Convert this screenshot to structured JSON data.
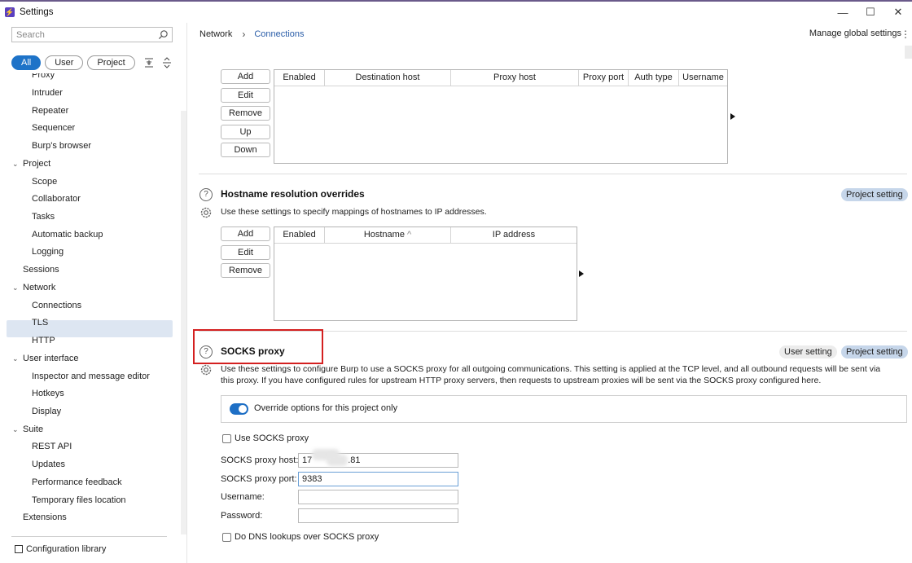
{
  "window": {
    "title": "Settings",
    "controls": [
      "—",
      "☐",
      "✕"
    ]
  },
  "sidebar": {
    "search_placeholder": "Search",
    "filters": [
      "All",
      "User",
      "Project"
    ],
    "items": [
      {
        "label": "Proxy",
        "level": 2
      },
      {
        "label": "Intruder",
        "level": 2
      },
      {
        "label": "Repeater",
        "level": 2
      },
      {
        "label": "Sequencer",
        "level": 2
      },
      {
        "label": "Burp's browser",
        "level": 2
      },
      {
        "label": "Project",
        "level": 1,
        "expanded": true
      },
      {
        "label": "Scope",
        "level": 2
      },
      {
        "label": "Collaborator",
        "level": 2
      },
      {
        "label": "Tasks",
        "level": 2
      },
      {
        "label": "Automatic backup",
        "level": 2
      },
      {
        "label": "Logging",
        "level": 2
      },
      {
        "label": "Sessions",
        "level": 1
      },
      {
        "label": "Network",
        "level": 1,
        "expanded": true
      },
      {
        "label": "Connections",
        "level": 2,
        "selected": true
      },
      {
        "label": "TLS",
        "level": 2
      },
      {
        "label": "HTTP",
        "level": 2
      },
      {
        "label": "User interface",
        "level": 1,
        "expanded": true
      },
      {
        "label": "Inspector and message editor",
        "level": 2
      },
      {
        "label": "Hotkeys",
        "level": 2
      },
      {
        "label": "Display",
        "level": 2
      },
      {
        "label": "Suite",
        "level": 1,
        "expanded": true
      },
      {
        "label": "REST API",
        "level": 2
      },
      {
        "label": "Updates",
        "level": 2
      },
      {
        "label": "Performance feedback",
        "level": 2
      },
      {
        "label": "Temporary files location",
        "level": 2
      },
      {
        "label": "Extensions",
        "level": 1
      }
    ],
    "config_library": "Configuration library"
  },
  "header": {
    "breadcrumb": [
      "Network",
      "Connections"
    ],
    "manage_global": "Manage global settings"
  },
  "upstream": {
    "buttons": [
      "Add",
      "Edit",
      "Remove",
      "Up",
      "Down"
    ],
    "columns": [
      "Enabled",
      "Destination host",
      "Proxy host",
      "Proxy port",
      "Auth type",
      "Username"
    ]
  },
  "hostname_overrides": {
    "title": "Hostname resolution overrides",
    "description": "Use these settings to specify mappings of hostnames to IP addresses.",
    "tag_project": "Project setting",
    "buttons": [
      "Add",
      "Edit",
      "Remove"
    ],
    "columns": [
      "Enabled",
      "Hostname",
      "IP address"
    ]
  },
  "socks": {
    "title": "SOCKS proxy",
    "tag_user": "User setting",
    "tag_project": "Project setting",
    "description_line1": "Use these settings to configure Burp to use a SOCKS proxy for all outgoing communications. This setting is applied at the TCP level, and all outbound requests will be sent via",
    "description_line2": "this proxy. If you have configured rules for upstream HTTP proxy servers, then requests to upstream proxies will be sent via the SOCKS proxy configured here.",
    "override_label": "Override options for this project only",
    "override_enabled": true,
    "use_socks_label": "Use SOCKS proxy",
    "host_label": "SOCKS proxy host:",
    "host_value_prefix": "17",
    "host_value_suffix": ".81",
    "port_label": "SOCKS proxy port:",
    "port_value": "9383",
    "username_label": "Username:",
    "password_label": "Password:",
    "dns_label": "Do DNS lookups over SOCKS proxy"
  },
  "colors": {
    "accent": "#1e73c8",
    "highlight": "#d42020",
    "selected_bg": "#dde6f2",
    "project_tag": "#c6d6ea"
  }
}
